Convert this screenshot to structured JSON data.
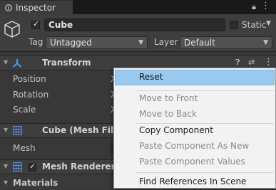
{
  "tab": {
    "label": "Inspector"
  },
  "header": {
    "active": true,
    "name": "Cube",
    "static_label": "Static",
    "tag_label": "Tag",
    "tag_value": "Untagged",
    "layer_label": "Layer",
    "layer_value": "Default"
  },
  "components": {
    "transform": {
      "title": "Transform",
      "props": [
        "Position",
        "Rotation",
        "Scale"
      ],
      "partials": [
        "X",
        "X",
        "X"
      ]
    },
    "mesh_filter": {
      "title": "Cube (Mesh Filte",
      "prop": "Mesh"
    },
    "mesh_renderer": {
      "title": "Mesh Renderer",
      "enabled": true
    },
    "materials": {
      "title": "Materials"
    }
  },
  "context_menu": {
    "items": [
      {
        "label": "Reset",
        "enabled": true,
        "highlighted": true
      },
      {
        "label": "Move to Front",
        "enabled": false
      },
      {
        "label": "Move to Back",
        "enabled": false
      },
      {
        "label": "Copy Component",
        "enabled": true
      },
      {
        "label": "Paste Component As New",
        "enabled": false
      },
      {
        "label": "Paste Component Values",
        "enabled": false
      },
      {
        "label": "Find References In Scene",
        "enabled": true
      }
    ]
  },
  "colors": {
    "background": "#383838",
    "menu_bg": "#f2f2f2",
    "menu_highlight": "#99c9ef",
    "transform_icon": "#4a9be8",
    "grid_icon": "#5b8fd9"
  }
}
